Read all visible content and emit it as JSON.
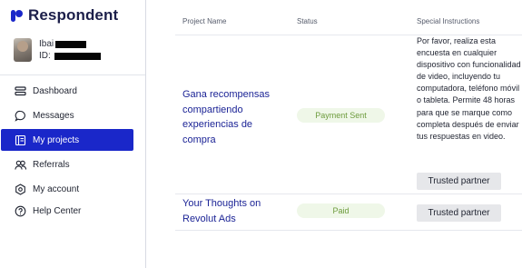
{
  "brand": {
    "name": "Respondent",
    "color": "#1c1f4a",
    "accent": "#1a27c9"
  },
  "profile": {
    "name": "Ibai",
    "id_label": "ID:"
  },
  "nav": [
    {
      "label": "Dashboard",
      "icon": "dashboard-icon",
      "active": false
    },
    {
      "label": "Messages",
      "icon": "message-bubble-icon",
      "active": false
    },
    {
      "label": "My projects",
      "icon": "projects-icon",
      "active": true
    },
    {
      "label": "Referrals",
      "icon": "people-icon",
      "active": false
    },
    {
      "label": "My account",
      "icon": "gear-icon",
      "active": false
    },
    {
      "label": "Help Center",
      "icon": "help-circle-icon",
      "active": false
    }
  ],
  "table": {
    "headers": {
      "project": "Project Name",
      "status": "Status",
      "instructions": "Special Instructions"
    },
    "rows": [
      {
        "project_lines": [
          "Gana recompensas",
          "compartiendo",
          "experiencias de",
          "compra"
        ],
        "status": "Payment Sent",
        "instructions": "Por favor, realiza esta encuesta en cualquier dispositivo con funcionalidad de video, incluyendo tu computadora, teléfono móvil o tableta. Permite 48 horas para que se marque como completa después de enviar tus respuestas en video.",
        "button": "Trusted partner"
      },
      {
        "project_lines": [
          "Your Thoughts on",
          "Revolut Ads"
        ],
        "status": "Paid",
        "instructions": "",
        "button": "Trusted partner"
      }
    ]
  },
  "status_colors": {
    "badge_bg": "#eff7e8",
    "badge_text": "#6e9c3e"
  }
}
